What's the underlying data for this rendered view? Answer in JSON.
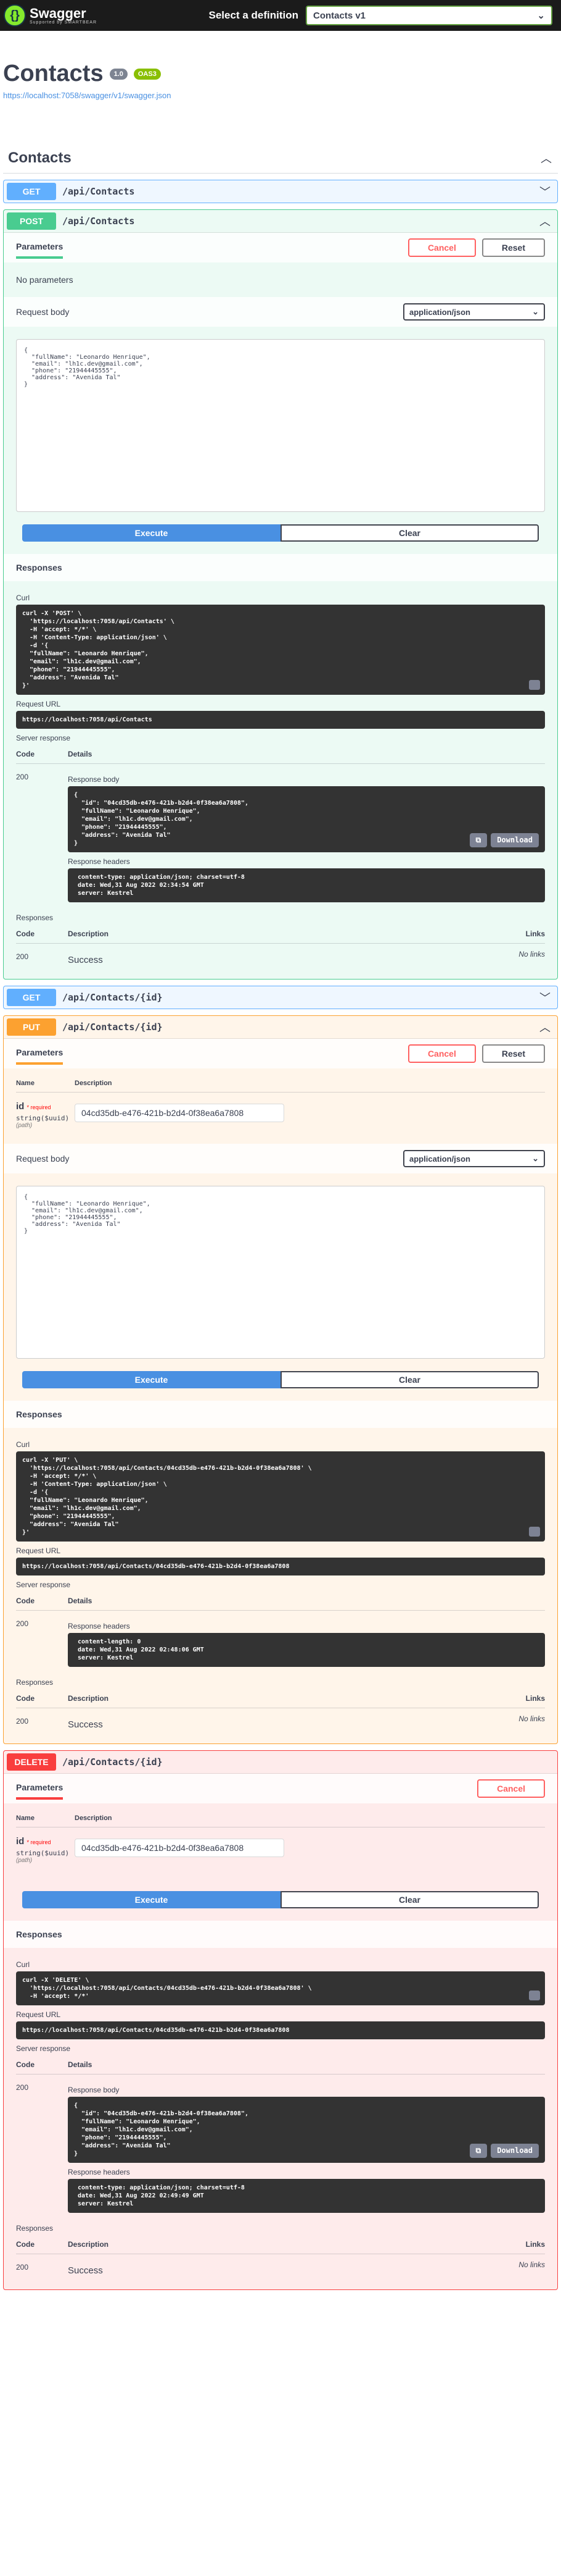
{
  "topbar": {
    "logo_text": "Swagger",
    "logo_sub": "Supported by SMARTBEAR",
    "select_label": "Select a definition",
    "definition": "Contacts v1"
  },
  "info": {
    "title": "Contacts",
    "version": "1.0",
    "oas": "OAS3",
    "url": "https://localhost:7058/swagger/v1/swagger.json"
  },
  "tag": {
    "name": "Contacts"
  },
  "ops": {
    "get_all": {
      "method": "GET",
      "path": "/api/Contacts"
    },
    "post": {
      "method": "POST",
      "path": "/api/Contacts",
      "tab": "Parameters",
      "cancel": "Cancel",
      "reset": "Reset",
      "no_params": "No parameters",
      "request_body": "Request body",
      "content_type": "application/json",
      "body": "{\n  \"fullName\": \"Leonardo Henrique\",\n  \"email\": \"lh1c.dev@gmail.com\",\n  \"phone\": \"21944445555\",\n  \"address\": \"Avenida Tal\"\n}",
      "execute": "Execute",
      "clear": "Clear",
      "responses": "Responses",
      "curl_label": "Curl",
      "curl": "curl -X 'POST' \\\n  'https://localhost:7058/api/Contacts' \\\n  -H 'accept: */*' \\\n  -H 'Content-Type: application/json' \\\n  -d '{\n  \"fullName\": \"Leonardo Henrique\",\n  \"email\": \"lh1c.dev@gmail.com\",\n  \"phone\": \"21944445555\",\n  \"address\": \"Avenida Tal\"\n}'",
      "request_url_label": "Request URL",
      "request_url": "https://localhost:7058/api/Contacts",
      "server_response": "Server response",
      "code_h": "Code",
      "details_h": "Details",
      "code": "200",
      "response_body_label": "Response body",
      "response_body": "{\n  \"id\": \"04cd35db-e476-421b-b2d4-0f38ea6a7808\",\n  \"fullName\": \"Leonardo Henrique\",\n  \"email\": \"lh1c.dev@gmail.com\",\n  \"phone\": \"21944445555\",\n  \"address\": \"Avenida Tal\"\n}",
      "download": "Download",
      "response_headers_label": "Response headers",
      "response_headers": " content-type: application/json; charset=utf-8\n date: Wed,31 Aug 2022 02:34:54 GMT\n server: Kestrel",
      "responses2": "Responses",
      "desc_h": "Description",
      "links_h": "Links",
      "resp_code": "200",
      "no_links": "No links",
      "success": "Success"
    },
    "get_id": {
      "method": "GET",
      "path": "/api/Contacts/{id}"
    },
    "put": {
      "method": "PUT",
      "path": "/api/Contacts/{id}",
      "tab": "Parameters",
      "cancel": "Cancel",
      "reset": "Reset",
      "name_h": "Name",
      "desc_h": "Description",
      "param_name": "id",
      "required": "* required",
      "param_type": "string($uuid)",
      "param_in": "(path)",
      "param_value": "04cd35db-e476-421b-b2d4-0f38ea6a7808",
      "request_body": "Request body",
      "content_type": "application/json",
      "body": "{\n  \"fullName\": \"Leonardo Henrique\",\n  \"email\": \"lh1c.dev@gmail.com\",\n  \"phone\": \"21944445555\",\n  \"address\": \"Avenida Tal\"\n}",
      "execute": "Execute",
      "clear": "Clear",
      "responses": "Responses",
      "curl_label": "Curl",
      "curl": "curl -X 'PUT' \\\n  'https://localhost:7058/api/Contacts/04cd35db-e476-421b-b2d4-0f38ea6a7808' \\\n  -H 'accept: */*' \\\n  -H 'Content-Type: application/json' \\\n  -d '{\n  \"fullName\": \"Leonardo Henrique\",\n  \"email\": \"lh1c.dev@gmail.com\",\n  \"phone\": \"21944445555\",\n  \"address\": \"Avenida Tal\"\n}'",
      "request_url_label": "Request URL",
      "request_url": "https://localhost:7058/api/Contacts/04cd35db-e476-421b-b2d4-0f38ea6a7808",
      "server_response": "Server response",
      "code_h": "Code",
      "details_h": "Details",
      "code": "200",
      "response_headers_label": "Response headers",
      "response_headers": " content-length: 0\n date: Wed,31 Aug 2022 02:48:06 GMT\n server: Kestrel",
      "responses2": "Responses",
      "links_h": "Links",
      "resp_code": "200",
      "no_links": "No links",
      "success": "Success"
    },
    "delete": {
      "method": "DELETE",
      "path": "/api/Contacts/{id}",
      "tab": "Parameters",
      "cancel": "Cancel",
      "name_h": "Name",
      "desc_h": "Description",
      "param_name": "id",
      "required": "* required",
      "param_type": "string($uuid)",
      "param_in": "(path)",
      "param_value": "04cd35db-e476-421b-b2d4-0f38ea6a7808",
      "execute": "Execute",
      "clear": "Clear",
      "responses": "Responses",
      "curl_label": "Curl",
      "curl": "curl -X 'DELETE' \\\n  'https://localhost:7058/api/Contacts/04cd35db-e476-421b-b2d4-0f38ea6a7808' \\\n  -H 'accept: */*'",
      "request_url_label": "Request URL",
      "request_url": "https://localhost:7058/api/Contacts/04cd35db-e476-421b-b2d4-0f38ea6a7808",
      "server_response": "Server response",
      "code_h": "Code",
      "details_h": "Details",
      "code": "200",
      "response_body_label": "Response body",
      "response_body": "{\n  \"id\": \"04cd35db-e476-421b-b2d4-0f38ea6a7808\",\n  \"fullName\": \"Leonardo Henrique\",\n  \"email\": \"lh1c.dev@gmail.com\",\n  \"phone\": \"21944445555\",\n  \"address\": \"Avenida Tal\"\n}",
      "download": "Download",
      "response_headers_label": "Response headers",
      "response_headers": " content-type: application/json; charset=utf-8\n date: Wed,31 Aug 2022 02:49:49 GMT\n server: Kestrel",
      "responses2": "Responses",
      "links_h": "Links",
      "resp_code": "200",
      "no_links": "No links",
      "success": "Success"
    }
  }
}
